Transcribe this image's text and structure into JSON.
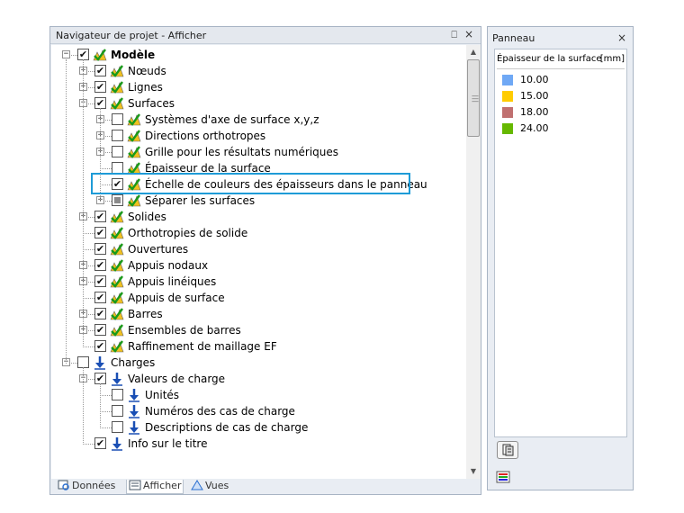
{
  "navigator": {
    "title": "Navigateur de projet - Afficher",
    "pin_glyph": "ª",
    "close_glyph": "×",
    "tree": [
      {
        "label": "Modèle",
        "depth": 0,
        "expander": "minus",
        "check": "checked",
        "icon": "model-icon",
        "bold": true
      },
      {
        "label": "Nœuds",
        "depth": 1,
        "expander": "plus",
        "check": "checked",
        "icon": "model-icon"
      },
      {
        "label": "Lignes",
        "depth": 1,
        "expander": "plus",
        "check": "checked",
        "icon": "model-icon"
      },
      {
        "label": "Surfaces",
        "depth": 1,
        "expander": "minus",
        "check": "checked",
        "icon": "model-icon"
      },
      {
        "label": "Systèmes d'axe de surface x,y,z",
        "depth": 2,
        "expander": "plus",
        "check": "unchecked",
        "icon": "model-icon"
      },
      {
        "label": "Directions orthotropes",
        "depth": 2,
        "expander": "plus",
        "check": "unchecked",
        "icon": "model-icon"
      },
      {
        "label": "Grille pour les résultats numériques",
        "depth": 2,
        "expander": "plus",
        "check": "unchecked",
        "icon": "model-icon"
      },
      {
        "label": "Épaisseur de la surface",
        "depth": 2,
        "expander": "none",
        "check": "unchecked",
        "icon": "model-icon"
      },
      {
        "label": "Échelle de couleurs des épaisseurs dans le panneau",
        "depth": 2,
        "expander": "none",
        "check": "checked",
        "icon": "model-icon"
      },
      {
        "label": "Séparer les surfaces",
        "depth": 2,
        "expander": "plus",
        "check": "partial",
        "icon": "model-icon"
      },
      {
        "label": "Solides",
        "depth": 1,
        "expander": "plus",
        "check": "checked",
        "icon": "model-icon"
      },
      {
        "label": "Orthotropies de solide",
        "depth": 1,
        "expander": "none",
        "check": "checked",
        "icon": "model-icon"
      },
      {
        "label": "Ouvertures",
        "depth": 1,
        "expander": "none",
        "check": "checked",
        "icon": "model-icon"
      },
      {
        "label": "Appuis nodaux",
        "depth": 1,
        "expander": "plus",
        "check": "checked",
        "icon": "model-icon"
      },
      {
        "label": "Appuis linéiques",
        "depth": 1,
        "expander": "plus",
        "check": "checked",
        "icon": "model-icon"
      },
      {
        "label": "Appuis de surface",
        "depth": 1,
        "expander": "none",
        "check": "checked",
        "icon": "model-icon"
      },
      {
        "label": "Barres",
        "depth": 1,
        "expander": "plus",
        "check": "checked",
        "icon": "model-icon"
      },
      {
        "label": "Ensembles de barres",
        "depth": 1,
        "expander": "plus",
        "check": "checked",
        "icon": "model-icon"
      },
      {
        "label": "Raffinement de maillage EF",
        "depth": 1,
        "expander": "none",
        "check": "checked",
        "icon": "model-icon"
      },
      {
        "label": "Charges",
        "depth": 0,
        "expander": "minus",
        "check": "unchecked",
        "icon": "load-arrow-icon"
      },
      {
        "label": "Valeurs de charge",
        "depth": 1,
        "expander": "minus",
        "check": "checked",
        "icon": "load-arrow-icon"
      },
      {
        "label": "Unités",
        "depth": 2,
        "expander": "none",
        "check": "unchecked",
        "icon": "load-arrow-icon"
      },
      {
        "label": "Numéros des cas de charge",
        "depth": 2,
        "expander": "none",
        "check": "unchecked",
        "icon": "load-arrow-icon"
      },
      {
        "label": "Descriptions de cas de charge",
        "depth": 2,
        "expander": "none",
        "check": "unchecked",
        "icon": "load-arrow-icon"
      },
      {
        "label": "Info sur le titre",
        "depth": 1,
        "expander": "none",
        "check": "checked",
        "icon": "load-arrow-icon"
      }
    ],
    "highlighted_label": "Échelle de couleurs des épaisseurs dans le panneau",
    "tabs": [
      {
        "label": "Données",
        "icon": "data-tab-icon",
        "active": false
      },
      {
        "label": "Afficher",
        "icon": "display-tab-icon",
        "active": true
      },
      {
        "label": "Vues",
        "icon": "views-tab-icon",
        "active": false
      }
    ]
  },
  "panel": {
    "title": "Panneau",
    "close_glyph": "×",
    "header_label": "Épaisseur de la surface",
    "header_unit": "[mm]",
    "legend": [
      {
        "value": "10.00",
        "color": "#6fa8f5"
      },
      {
        "value": "15.00",
        "color": "#ffcc00"
      },
      {
        "value": "18.00",
        "color": "#c07070"
      },
      {
        "value": "24.00",
        "color": "#66b800"
      }
    ]
  },
  "colors": {
    "highlight_border": "#1e9bd7",
    "window_bg": "#e9edf3"
  }
}
